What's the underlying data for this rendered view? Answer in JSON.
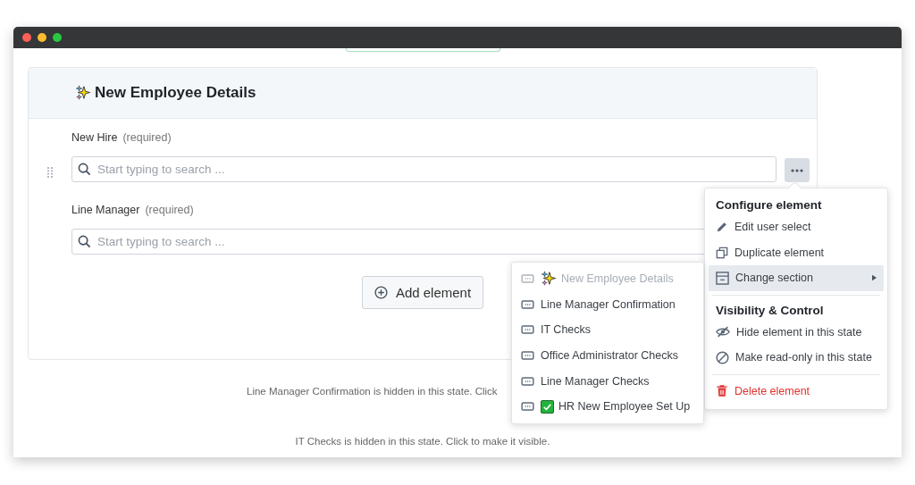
{
  "section": {
    "title": "New Employee Details",
    "kind": "sparkles"
  },
  "fields": [
    {
      "label": "New Hire",
      "note": "(required)",
      "placeholder": "Start typing to search ...",
      "menu_open": true
    },
    {
      "label": "Line Manager",
      "note": "(required)",
      "placeholder": "Start typing to search ..."
    }
  ],
  "add_button": "Add element",
  "hidden_notes": [
    "Line Manager Confirmation is hidden in this state. Click",
    "IT Checks is hidden in this state. Click to make it visible."
  ],
  "menu": {
    "groups": [
      {
        "heading": "Configure element",
        "items": [
          {
            "label": "Edit user select",
            "kind": "edit",
            "highlighted": false
          },
          {
            "label": "Duplicate element",
            "kind": "duplicate",
            "highlighted": false
          },
          {
            "label": "Change section",
            "kind": "submenu",
            "highlighted": true
          }
        ]
      },
      {
        "heading": "Visibility & Control",
        "items": [
          {
            "label": "Hide element in this state",
            "kind": "hide",
            "highlighted": false
          },
          {
            "label": "Make read-only in this state",
            "kind": "readonly",
            "highlighted": false
          }
        ]
      },
      {
        "items": [
          {
            "label": "Delete element",
            "kind": "delete",
            "highlighted": false
          }
        ]
      }
    ]
  },
  "submenu": [
    {
      "label": "New Employee Details",
      "kind": "sparkles",
      "disabled": true
    },
    {
      "label": "Line Manager Confirmation",
      "disabled": false
    },
    {
      "label": "IT Checks",
      "disabled": false
    },
    {
      "label": "Office Administrator Checks",
      "disabled": false
    },
    {
      "label": "Line Manager Checks",
      "disabled": false
    },
    {
      "label": "HR New Employee Set Up",
      "kind": "check",
      "disabled": false
    }
  ]
}
